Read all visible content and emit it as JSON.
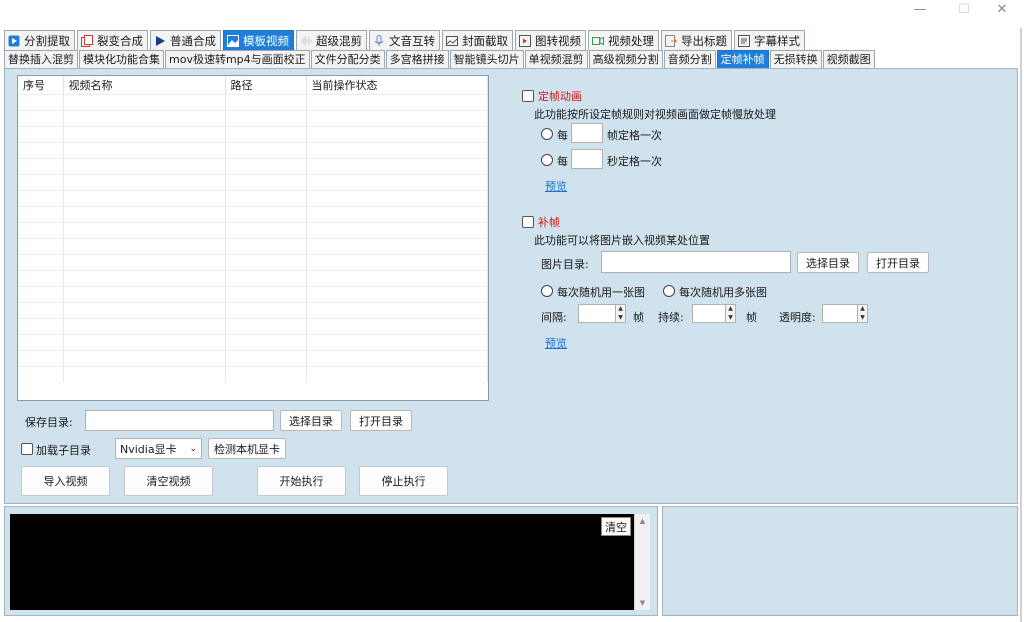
{
  "tabs_primary": [
    {
      "label": "分割提取",
      "icon": "play-square-icon",
      "color": "#1f7fd8"
    },
    {
      "label": "裂变合成",
      "icon": "copy-icon",
      "color": "#d03a3a"
    },
    {
      "label": "普通合成",
      "icon": "play-icon",
      "color": "#1a3a8a"
    },
    {
      "label": "模板视频",
      "icon": "image-icon",
      "color": "#ffffff"
    },
    {
      "label": "超级混剪",
      "icon": "waveform-icon",
      "color": "#cccccc"
    },
    {
      "label": "文音互转",
      "icon": "microphone-icon",
      "color": "#6a8ad0"
    },
    {
      "label": "封面截取",
      "icon": "picture-icon",
      "color": "#555555"
    },
    {
      "label": "图转视频",
      "icon": "slideshow-icon",
      "color": "#c03a3a"
    },
    {
      "label": "视频处理",
      "icon": "video-process-icon",
      "color": "#3a9a5a"
    },
    {
      "label": "导出标题",
      "icon": "export-icon",
      "color": "#d08a3a"
    },
    {
      "label": "字幕样式",
      "icon": "subtitle-icon",
      "color": "#555555"
    }
  ],
  "tabs_primary_active": 3,
  "tabs_secondary": [
    "替换插入混剪",
    "模块化功能合集",
    "mov极速转mp4与画面校正",
    "文件分配分类",
    "多宫格拼接",
    "智能镜头切片",
    "单视频混剪",
    "高级视频分割",
    "音频分割",
    "定帧补帧",
    "无损转换",
    "视频截图"
  ],
  "tabs_secondary_active": 9,
  "table": {
    "headers": [
      "序号",
      "视频名称",
      "路径",
      "当前操作状态"
    ],
    "rows": []
  },
  "save": {
    "label": "保存目录:",
    "value": "",
    "choose_btn": "选择目录",
    "open_btn": "打开目录"
  },
  "subdir_label": "加载子目录",
  "gpu": {
    "selected": "Nvidia显卡",
    "detect_btn": "检测本机显卡"
  },
  "actions": {
    "import": "导入视频",
    "clear": "清空视频",
    "start": "开始执行",
    "stop": "停止执行"
  },
  "freeze": {
    "title": "定帧动画",
    "desc": "此功能按所设定帧规则对视频画面做定帧慢放处理",
    "opt1_prefix": "每",
    "opt1_suffix": "帧定格一次",
    "opt2_prefix": "每",
    "opt2_suffix": "秒定格一次",
    "preview": "预览"
  },
  "fill": {
    "title": "补帧",
    "desc": "此功能可以将图片嵌入视频某处位置",
    "img_dir_label": "图片目录:",
    "img_dir_value": "",
    "choose_btn": "选择目录",
    "open_btn": "打开目录",
    "random_one": "每次随机用一张图",
    "random_many": "每次随机用多张图",
    "interval_label": "间隔:",
    "interval_unit": "帧",
    "duration_label": "持续:",
    "duration_unit": "帧",
    "opacity_label": "透明度:",
    "preview": "预览"
  },
  "log": {
    "clear_btn": "清空"
  },
  "window": {
    "minimize": "—",
    "maximize": "☐",
    "close": "✕"
  }
}
